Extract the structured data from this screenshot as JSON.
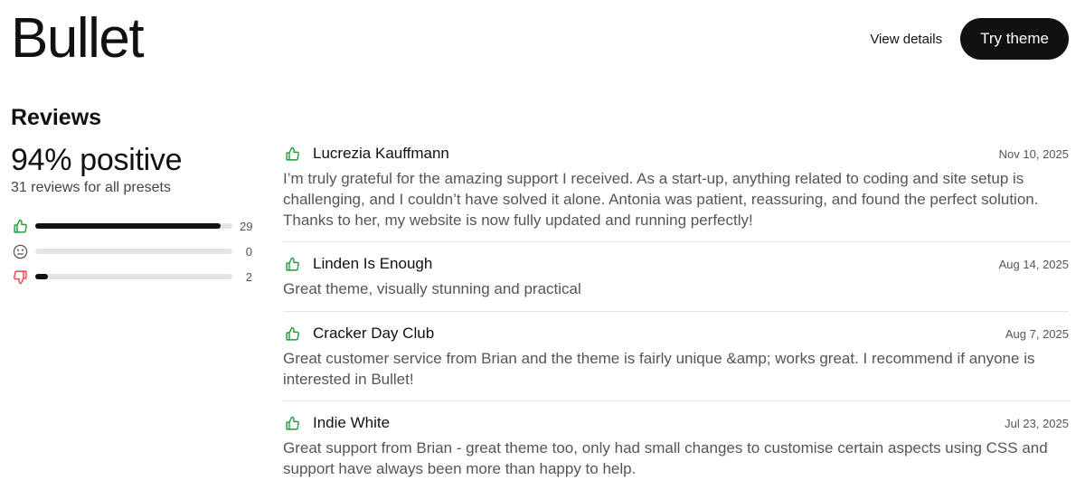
{
  "header": {
    "title": "Bullet",
    "view_details_label": "View details",
    "try_theme_label": "Try theme"
  },
  "summary": {
    "heading": "Reviews",
    "positive": "94% positive",
    "count_text": "31 reviews for all presets",
    "ratings": [
      {
        "type": "positive",
        "icon": "thumbs-up-icon",
        "count": "29",
        "fraction": 0.94,
        "color": "#1f9d3a"
      },
      {
        "type": "neutral",
        "icon": "neutral-face-icon",
        "count": "0",
        "fraction": 0.0,
        "color": "#555555"
      },
      {
        "type": "negative",
        "icon": "thumbs-down-icon",
        "count": "2",
        "fraction": 0.065,
        "color": "#e04848"
      }
    ]
  },
  "reviews": [
    {
      "name": "Lucrezia Kauffmann",
      "date": "Nov 10, 2025",
      "text": "I’m truly grateful for the amazing support I received. As a start-up, anything related to coding and site setup is challenging, and I couldn’t have solved it alone. Antonia was patient, reassuring, and found the perfect solution. Thanks to her, my website is now fully updated and running perfectly!"
    },
    {
      "name": "Linden Is Enough",
      "date": "Aug 14, 2025",
      "text": "Great theme, visually stunning and practical"
    },
    {
      "name": "Cracker Day Club",
      "date": "Aug 7, 2025",
      "text": "Great customer service from Brian and the theme is fairly unique &amp; works great. I recommend if anyone is interested in Bullet!"
    },
    {
      "name": "Indie White",
      "date": "Jul 23, 2025",
      "text": "Great support from Brian - great theme too, only had small changes to customise certain aspects using CSS and support have always been more than happy to help."
    }
  ],
  "colors": {
    "accent_positive": "#1f9d3a",
    "accent_negative": "#e04848",
    "button_bg": "#111111"
  }
}
